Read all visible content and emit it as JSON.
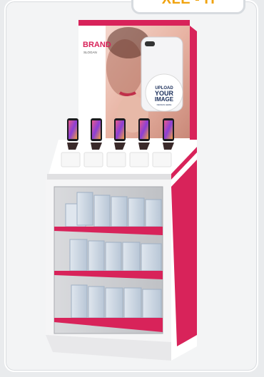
{
  "badge": {
    "label": "XLE - H"
  },
  "header_panel": {
    "brand": "BRAND",
    "slogan": "SLOGAN",
    "upload_lines": [
      "UPLOAD",
      "YOUR",
      "IMAGE",
      "DESIGN HERE"
    ]
  },
  "colors": {
    "accent": "#d8235a",
    "body": "#ffffff",
    "badge_text": "#f0a30f",
    "badge_border": "#d7dbdf"
  },
  "phones": {
    "count": 5
  },
  "shelves": {
    "count": 3
  }
}
